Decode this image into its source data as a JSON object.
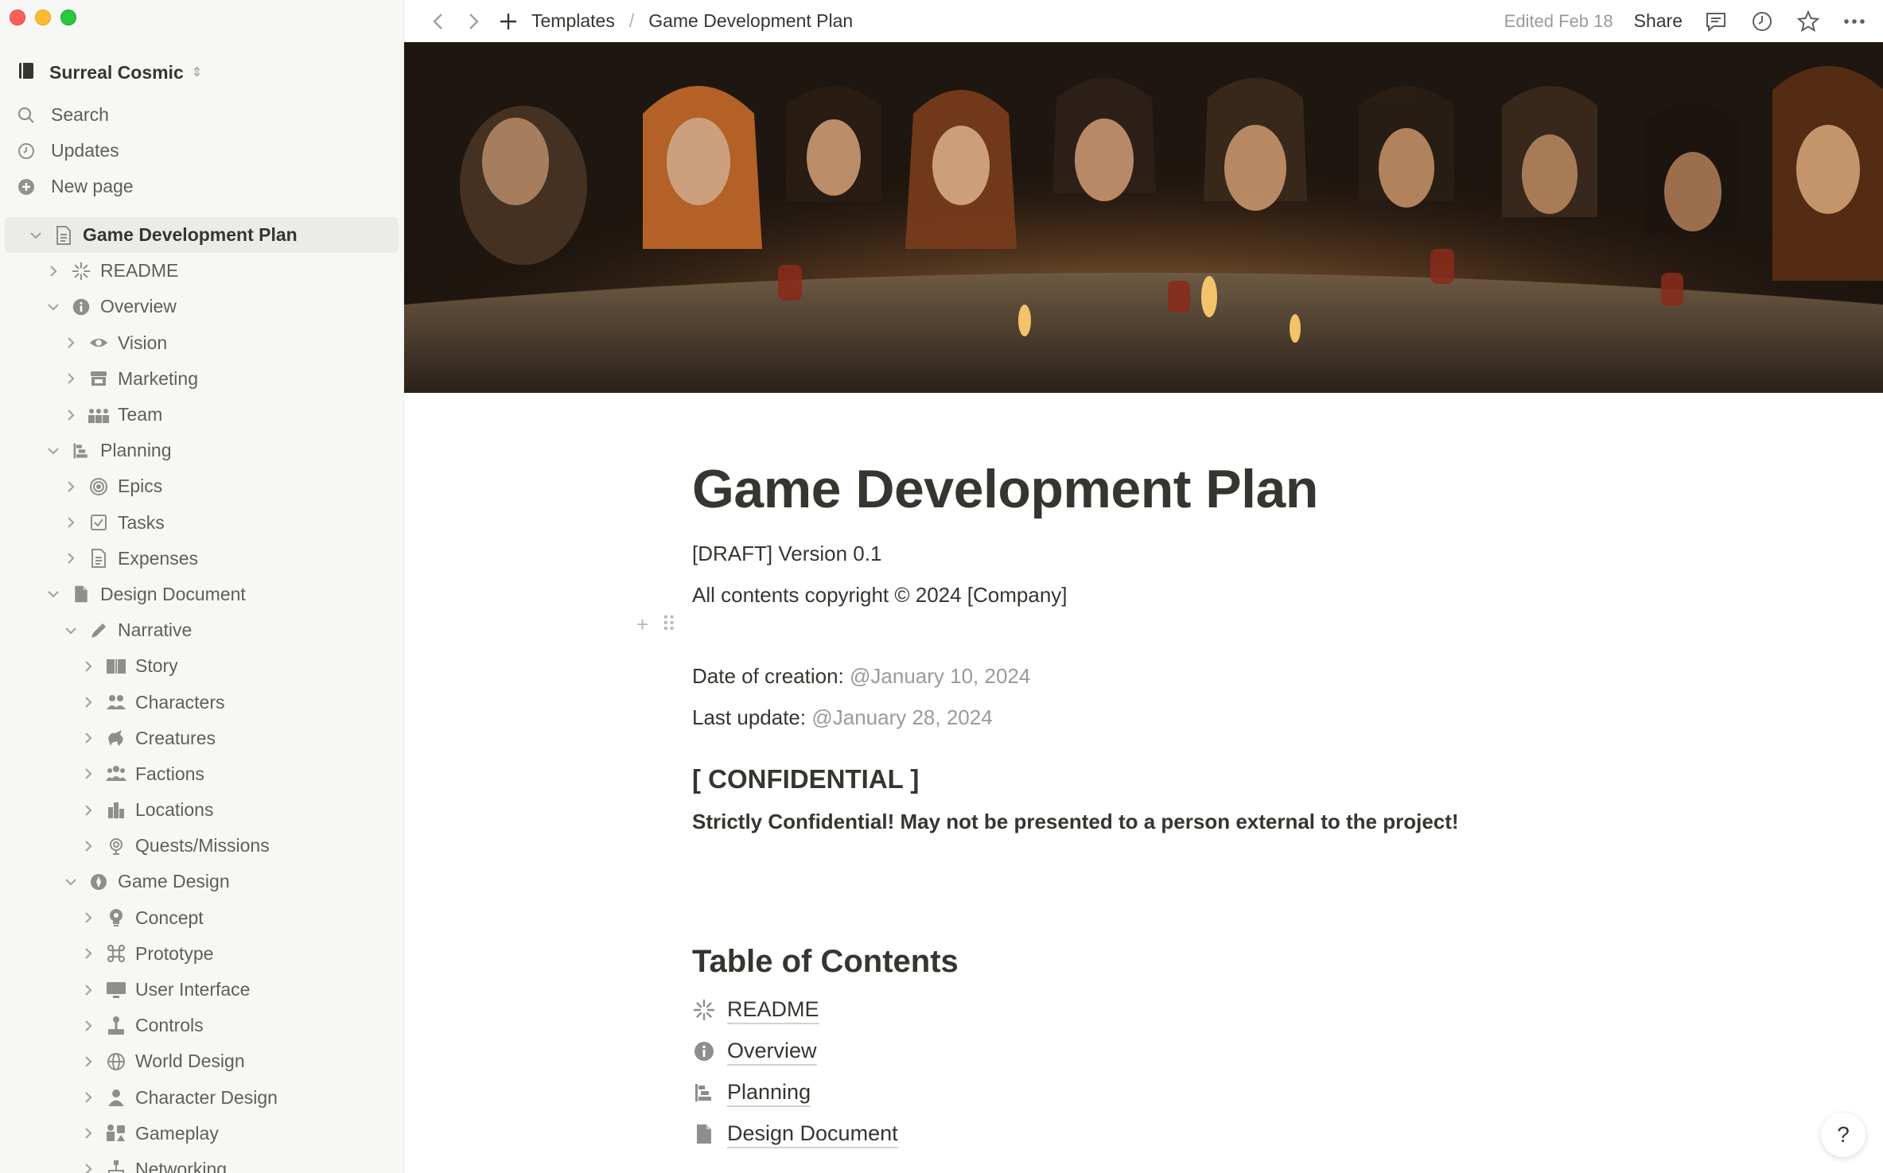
{
  "window": {
    "controls": [
      "close",
      "minimize",
      "zoom"
    ]
  },
  "sidebar": {
    "workspace": {
      "name": "Surreal Cosmic",
      "icon": "notebook-icon"
    },
    "top_nav": [
      {
        "label": "Search",
        "icon": "search-icon"
      },
      {
        "label": "Updates",
        "icon": "clock-icon"
      },
      {
        "label": "New page",
        "icon": "plus-circle-icon"
      }
    ],
    "tree": [
      {
        "label": "Game Development Plan",
        "icon": "page-icon",
        "level": 0,
        "expanded": true,
        "active": true
      },
      {
        "label": "README",
        "icon": "sparkle-icon",
        "level": 1,
        "expanded": false
      },
      {
        "label": "Overview",
        "icon": "info-icon",
        "level": 1,
        "expanded": true
      },
      {
        "label": "Vision",
        "icon": "eye-icon",
        "level": 2,
        "expanded": false
      },
      {
        "label": "Marketing",
        "icon": "store-icon",
        "level": 2,
        "expanded": false
      },
      {
        "label": "Team",
        "icon": "team-icon",
        "level": 2,
        "expanded": false
      },
      {
        "label": "Planning",
        "icon": "timeline-icon",
        "level": 1,
        "expanded": true
      },
      {
        "label": "Epics",
        "icon": "target-icon",
        "level": 2,
        "expanded": false
      },
      {
        "label": "Tasks",
        "icon": "checkbox-icon",
        "level": 2,
        "expanded": false
      },
      {
        "label": "Expenses",
        "icon": "document-icon",
        "level": 2,
        "expanded": false
      },
      {
        "label": "Design Document",
        "icon": "file-icon",
        "level": 1,
        "expanded": true
      },
      {
        "label": "Narrative",
        "icon": "pencil-icon",
        "level": 2,
        "expanded": true
      },
      {
        "label": "Story",
        "icon": "book-icon",
        "level": 3,
        "expanded": false
      },
      {
        "label": "Characters",
        "icon": "people-icon",
        "level": 3,
        "expanded": false
      },
      {
        "label": "Creatures",
        "icon": "creature-icon",
        "level": 3,
        "expanded": false
      },
      {
        "label": "Factions",
        "icon": "group-icon",
        "level": 3,
        "expanded": false
      },
      {
        "label": "Locations",
        "icon": "buildings-icon",
        "level": 3,
        "expanded": false
      },
      {
        "label": "Quests/Missions",
        "icon": "quest-icon",
        "level": 3,
        "expanded": false
      },
      {
        "label": "Game Design",
        "icon": "compass-icon",
        "level": 2,
        "expanded": true
      },
      {
        "label": "Concept",
        "icon": "lightbulb-icon",
        "level": 3,
        "expanded": false
      },
      {
        "label": "Prototype",
        "icon": "command-icon",
        "level": 3,
        "expanded": false
      },
      {
        "label": "User Interface",
        "icon": "monitor-icon",
        "level": 3,
        "expanded": false
      },
      {
        "label": "Controls",
        "icon": "joystick-icon",
        "level": 3,
        "expanded": false
      },
      {
        "label": "World Design",
        "icon": "globe-icon",
        "level": 3,
        "expanded": false
      },
      {
        "label": "Character Design",
        "icon": "person-icon",
        "level": 3,
        "expanded": false
      },
      {
        "label": "Gameplay",
        "icon": "game-pieces-icon",
        "level": 3,
        "expanded": false
      },
      {
        "label": "Networking",
        "icon": "network-icon",
        "level": 3,
        "expanded": false
      }
    ]
  },
  "topbar": {
    "breadcrumb": [
      "Templates",
      "Game Development Plan"
    ],
    "edited": "Edited Feb 18",
    "share_label": "Share",
    "icons": [
      "comment-icon",
      "history-icon",
      "star-icon",
      "more-icon"
    ]
  },
  "cover": {
    "description_icon": "cover-image"
  },
  "page": {
    "title": "Game Development Plan",
    "draft": "[DRAFT] Version 0.1",
    "copyright": "All contents copyright © 2024 [Company]",
    "creation_label": "Date of creation: ",
    "creation_date": "@January 10, 2024",
    "update_label": "Last update: ",
    "update_date": "@January 28, 2024",
    "confidential_heading": "[ CONFIDENTIAL ]",
    "confidential_text": "Strictly Confidential! May not be presented to a person external to the project!",
    "toc_heading": "Table of Contents",
    "toc": [
      {
        "label": "README",
        "icon": "sparkle-icon"
      },
      {
        "label": "Overview",
        "icon": "info-icon"
      },
      {
        "label": "Planning",
        "icon": "timeline-icon"
      },
      {
        "label": "Design Document",
        "icon": "file-icon"
      }
    ]
  },
  "help_label": "?"
}
